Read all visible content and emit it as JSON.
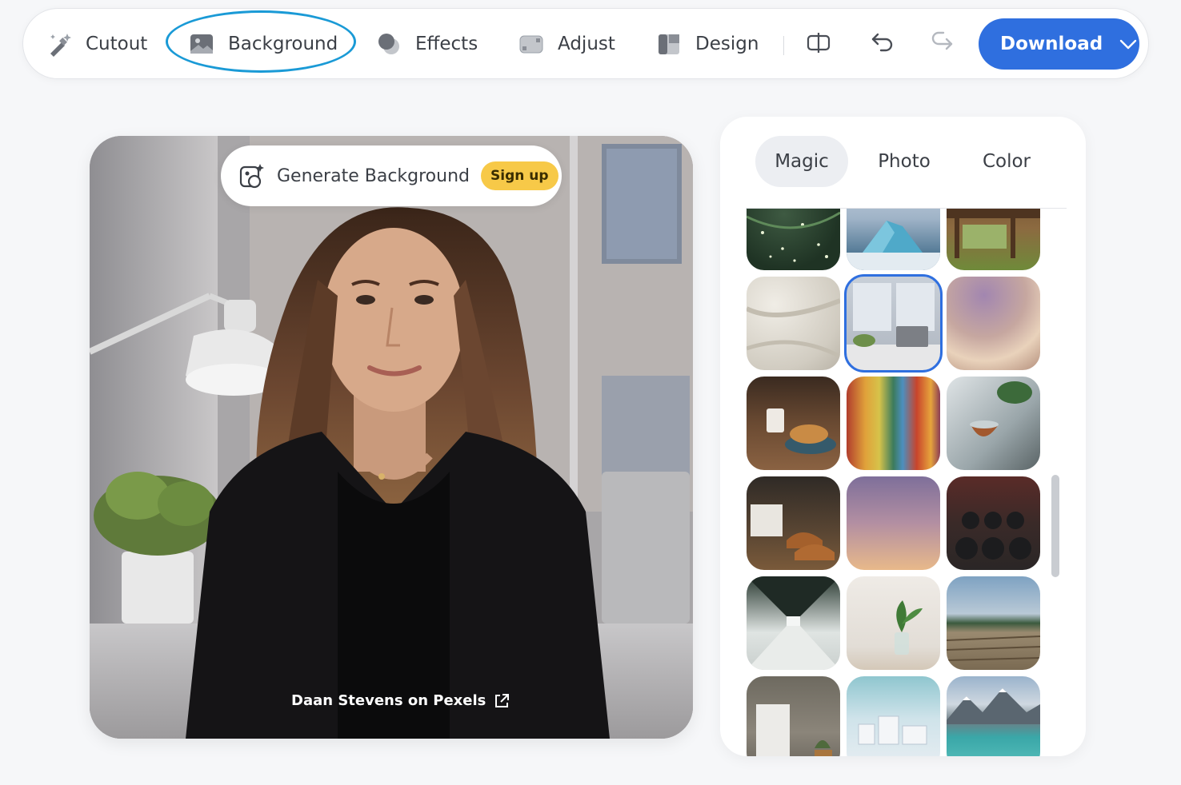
{
  "toolbar": {
    "tools": [
      {
        "label": "Cutout",
        "icon": "magic-brush-icon"
      },
      {
        "label": "Background",
        "icon": "image-icon"
      },
      {
        "label": "Effects",
        "icon": "effects-circles-icon"
      },
      {
        "label": "Adjust",
        "icon": "adjust-icon"
      },
      {
        "label": "Design",
        "icon": "design-layout-icon"
      }
    ],
    "active_tool": "Background",
    "download_label": "Download",
    "accent_color": "#2f6fdf",
    "highlight_color": "#1a9ad6"
  },
  "canvas": {
    "generate_label": "Generate Background",
    "signup_label": "Sign up",
    "credit": "Daan Stevens on Pexels"
  },
  "panel": {
    "tabs": [
      "Magic",
      "Photo",
      "Color"
    ],
    "active_tab": "Magic",
    "thumbnails": [
      {
        "name": "pine-branches-lights"
      },
      {
        "name": "iceberg"
      },
      {
        "name": "log-cabin-porch"
      },
      {
        "name": "white-fabric"
      },
      {
        "name": "office-desk-window",
        "selected": true
      },
      {
        "name": "purple-gradient-blur"
      },
      {
        "name": "cafe-croissant"
      },
      {
        "name": "colorful-blur-stripes"
      },
      {
        "name": "tea-cup-windowsill"
      },
      {
        "name": "shoes-clothes-shop"
      },
      {
        "name": "purple-sunset-gradient"
      },
      {
        "name": "kettlebells-rack"
      },
      {
        "name": "glass-corridor"
      },
      {
        "name": "plant-vase-wall"
      },
      {
        "name": "lake-dock"
      },
      {
        "name": "concrete-room-door"
      },
      {
        "name": "white-city-model"
      },
      {
        "name": "mountain-lake"
      }
    ]
  }
}
